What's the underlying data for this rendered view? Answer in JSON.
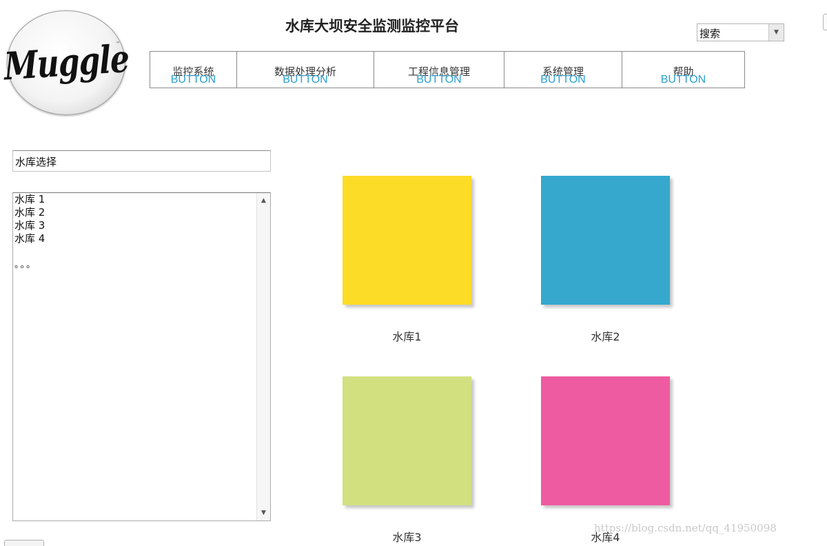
{
  "logo": {
    "text": "Muggle",
    "tm": "™"
  },
  "header": {
    "title": "水库大坝安全监测监控平台"
  },
  "search": {
    "label": "搜索",
    "arrow": "▼"
  },
  "nav": {
    "items": [
      {
        "label": "监控系统",
        "button": "BUTTON"
      },
      {
        "label": "数据处理分析",
        "button": "BUTTON"
      },
      {
        "label": "工程信息管理",
        "button": "BUTTON"
      },
      {
        "label": "系统管理",
        "button": "BUTTON"
      },
      {
        "label": "帮助",
        "button": "BUTTON"
      }
    ]
  },
  "sidebar": {
    "select_label": "水库选择",
    "list": [
      "水库 1",
      "水库 2",
      "水库 3",
      "水库 4"
    ],
    "dots": "。。。",
    "scroll_up": "▲",
    "scroll_down": "▼"
  },
  "reservoirs": [
    {
      "label": "水库1",
      "color": "#fddc27"
    },
    {
      "label": "水库2",
      "color": "#36a8ce"
    },
    {
      "label": "水库3",
      "color": "#d3e080"
    },
    {
      "label": "水库4",
      "color": "#ef5ba0"
    }
  ],
  "watermark": "https://blog.csdn.net/qq_41950098"
}
